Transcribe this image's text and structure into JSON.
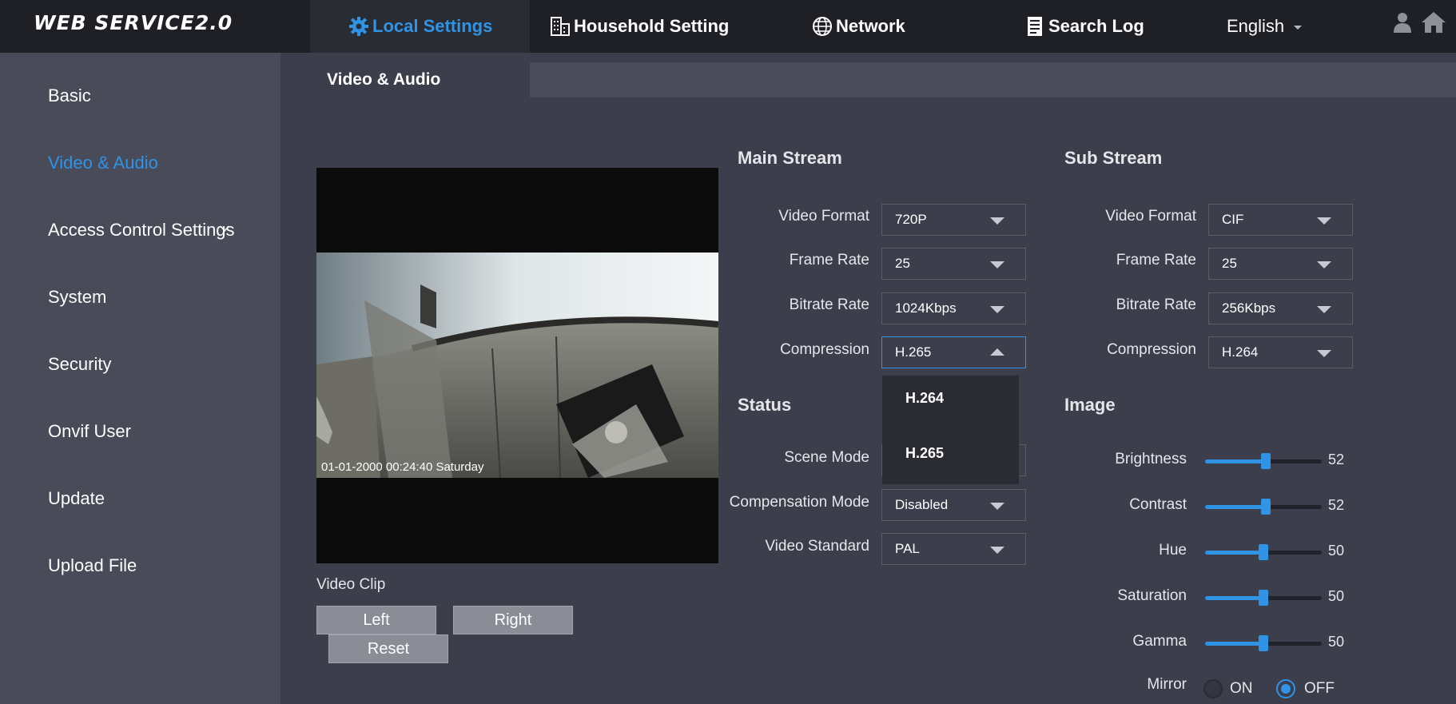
{
  "app": {
    "logo": "WEB SERVICE2.0"
  },
  "nav": {
    "local_settings": "Local Settings",
    "household_setting": "Household Setting",
    "network": "Network",
    "search_log": "Search Log",
    "language": "English"
  },
  "sidebar": {
    "items": [
      "Basic",
      "Video & Audio",
      "Access Control Settings",
      "System",
      "Security",
      "Onvif User",
      "Update",
      "Upload File"
    ],
    "active": "Video & Audio"
  },
  "tab": {
    "label": "Video & Audio"
  },
  "video": {
    "timestamp": "01-01-2000 00:24:40 Saturday"
  },
  "clip": {
    "label": "Video Clip",
    "left": "Left",
    "right": "Right",
    "reset": "Reset"
  },
  "main_stream": {
    "title": "Main Stream",
    "video_format": {
      "label": "Video Format",
      "value": "720P"
    },
    "frame_rate": {
      "label": "Frame Rate",
      "value": "25"
    },
    "bitrate_rate": {
      "label": "Bitrate Rate",
      "value": "1024Kbps"
    },
    "compression": {
      "label": "Compression",
      "value": "H.265",
      "options": [
        "H.264",
        "H.265"
      ]
    }
  },
  "sub_stream": {
    "title": "Sub Stream",
    "video_format": {
      "label": "Video Format",
      "value": "CIF"
    },
    "frame_rate": {
      "label": "Frame Rate",
      "value": "25"
    },
    "bitrate_rate": {
      "label": "Bitrate Rate",
      "value": "256Kbps"
    },
    "compression": {
      "label": "Compression",
      "value": "H.264"
    }
  },
  "status": {
    "title": "Status",
    "scene_mode": {
      "label": "Scene Mode",
      "value": ""
    },
    "compensation_mode": {
      "label": "Compensation Mode",
      "value": "Disabled"
    },
    "video_standard": {
      "label": "Video Standard",
      "value": "PAL"
    }
  },
  "image": {
    "title": "Image",
    "sliders": [
      {
        "label": "Brightness",
        "value": 52,
        "max": 100
      },
      {
        "label": "Contrast",
        "value": 52,
        "max": 100
      },
      {
        "label": "Hue",
        "value": 50,
        "max": 100
      },
      {
        "label": "Saturation",
        "value": 50,
        "max": 100
      },
      {
        "label": "Gamma",
        "value": 50,
        "max": 100
      }
    ],
    "mirror": {
      "label": "Mirror",
      "on_label": "ON",
      "off_label": "OFF",
      "selected": "OFF"
    }
  },
  "colors": {
    "accent": "#2f93e6",
    "topbar": "#1f2026",
    "sidebar": "#494b58",
    "content": "#3c3e4c"
  }
}
